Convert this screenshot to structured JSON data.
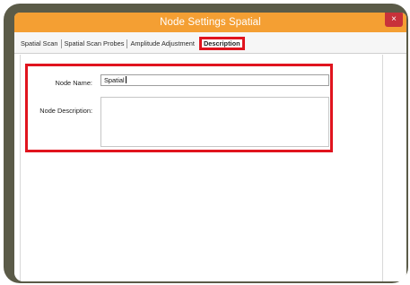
{
  "window": {
    "title": "Node Settings   Spatial",
    "close_label": "×"
  },
  "tabs": [
    {
      "label": "Spatial Scan",
      "active": false
    },
    {
      "label": "Spatial Scan Probes",
      "active": false
    },
    {
      "label": "Amplitude Adjustment",
      "active": false
    },
    {
      "label": "Description",
      "active": true
    }
  ],
  "form": {
    "node_name_label": "Node Name:",
    "node_name_value": "Spatial",
    "node_description_label": "Node Description:",
    "node_description_value": ""
  },
  "colors": {
    "titlebar": "#f49f33",
    "highlight": "#e0141e",
    "frame": "#5b5b48"
  }
}
